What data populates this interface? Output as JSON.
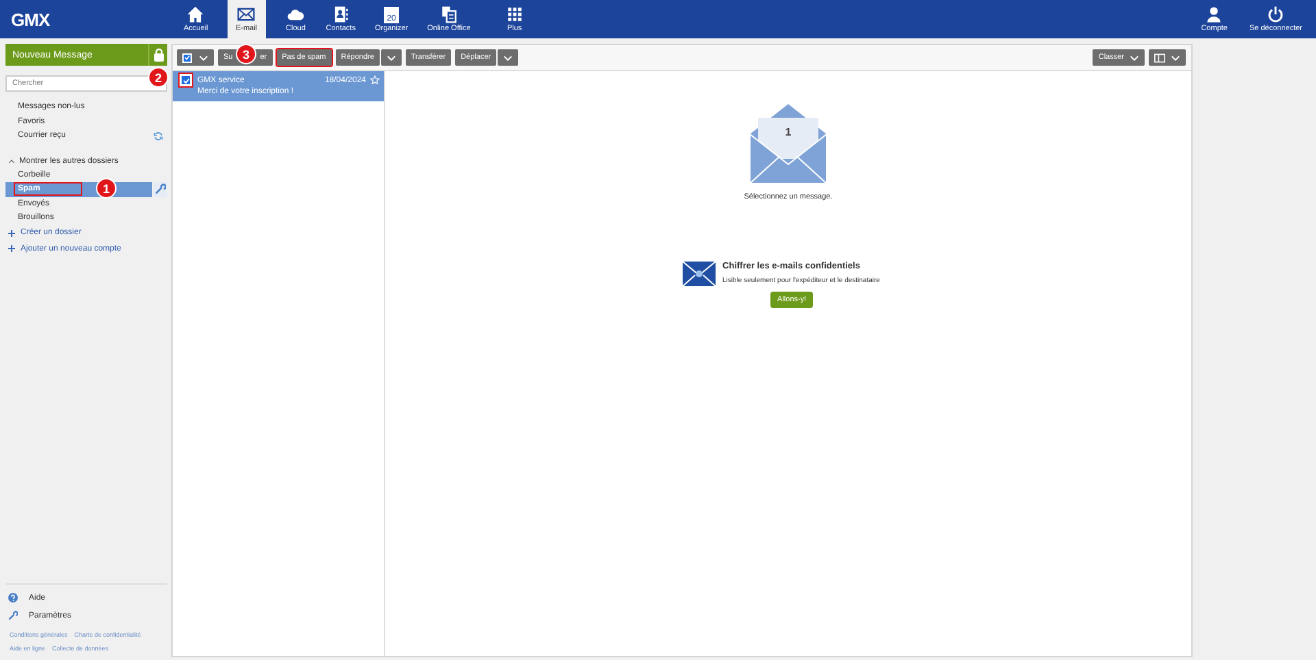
{
  "topbar": {
    "logo": "GMX",
    "nav": [
      {
        "label": "Accueil",
        "selected": false
      },
      {
        "label": "E-mail",
        "selected": true
      },
      {
        "label": "Cloud",
        "selected": false
      },
      {
        "label": "Contacts",
        "selected": false
      },
      {
        "label": "Organizer",
        "day": "20",
        "selected": false
      },
      {
        "label": "Online Office",
        "selected": false
      },
      {
        "label": "Plus",
        "selected": false
      }
    ],
    "account": [
      {
        "label": "Compte"
      },
      {
        "label": "Se déconnecter"
      }
    ]
  },
  "sidebar": {
    "new_message": "Nouveau Message",
    "search": {
      "placeholder": "Chercher",
      "badge": "2"
    },
    "quick": [
      {
        "label": "Messages non-lus",
        "refresh": false
      },
      {
        "label": "Favoris",
        "refresh": false
      },
      {
        "label": "Courrier reçu",
        "refresh": true
      }
    ],
    "toggle": {
      "label": "Montrer les autres dossiers",
      "expanded": true
    },
    "folders": [
      {
        "label": "Corbeille",
        "selected": false,
        "highlighted": false
      },
      {
        "label": "Spam",
        "selected": true,
        "highlighted": true,
        "badge": "1"
      },
      {
        "label": "Envoyés",
        "selected": false,
        "highlighted": false
      },
      {
        "label": "Brouillons",
        "selected": false,
        "highlighted": false
      }
    ],
    "actions": [
      "Créer un dossier",
      "Ajouter un nouveau compte"
    ],
    "help": [
      {
        "label": "Aide"
      },
      {
        "label": "Paramètres"
      }
    ],
    "links": [
      [
        "Conditions générales",
        "Charte de confidentialité"
      ],
      [
        "Aide en ligne",
        "Collecte de données"
      ]
    ]
  },
  "toolbar": {
    "select_all": {
      "checked": true
    },
    "buttons": [
      {
        "label_parts": [
          "Su",
          "er"
        ],
        "badge": "3",
        "highlighted": false,
        "dropdown": false
      },
      {
        "label_parts": [
          "Pas de spam"
        ],
        "highlighted": true,
        "dropdown": false
      },
      {
        "label_parts": [
          "Répondre"
        ],
        "highlighted": false,
        "dropdown": true
      },
      {
        "label_parts": [
          "Transférer"
        ],
        "highlighted": false,
        "dropdown": false
      },
      {
        "label_parts": [
          "Déplacer"
        ],
        "highlighted": false,
        "dropdown": true
      }
    ],
    "right": [
      {
        "kind": "text",
        "label": "Classer"
      },
      {
        "kind": "layout"
      }
    ]
  },
  "messages": [
    {
      "sender": "GMX service",
      "date": "18/04/2024",
      "subject": "Merci de votre inscription !",
      "selected": true,
      "checked": true,
      "highlighted": true,
      "starred": false
    }
  ],
  "reading": {
    "count": "1",
    "hint": "Sélectionnez un message.",
    "promo": {
      "title": "Chiffrer les e-mails confidentiels",
      "text": "Lisible seulement pour l'expéditeur et le destinataire",
      "button": "Allons-y!"
    }
  }
}
